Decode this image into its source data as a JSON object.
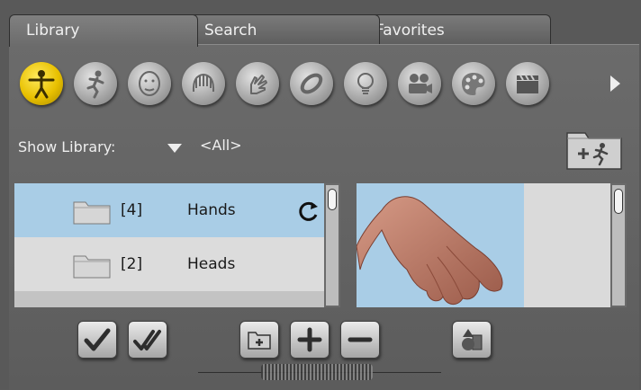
{
  "tabs": [
    {
      "label": "Library",
      "active": true
    },
    {
      "label": "Search",
      "active": false
    },
    {
      "label": "Favorites",
      "active": false
    }
  ],
  "categories": [
    {
      "icon": "figure-icon",
      "active": true
    },
    {
      "icon": "pose-icon",
      "active": false
    },
    {
      "icon": "face-icon",
      "active": false
    },
    {
      "icon": "hair-icon",
      "active": false
    },
    {
      "icon": "hand-icon",
      "active": false
    },
    {
      "icon": "props-icon",
      "active": false
    },
    {
      "icon": "light-icon",
      "active": false
    },
    {
      "icon": "camera-icon",
      "active": false
    },
    {
      "icon": "materials-icon",
      "active": false
    },
    {
      "icon": "clapboard-icon",
      "active": false
    }
  ],
  "show_library": {
    "label": "Show Library:",
    "value": "<All>"
  },
  "list": {
    "items": [
      {
        "count": "[4]",
        "name": "Hands",
        "selected": true
      },
      {
        "count": "[2]",
        "name": "Heads",
        "selected": false
      }
    ]
  },
  "colors": {
    "selected": "#a9cde6",
    "active_icon": "#e8c000",
    "panel": "#666666"
  }
}
